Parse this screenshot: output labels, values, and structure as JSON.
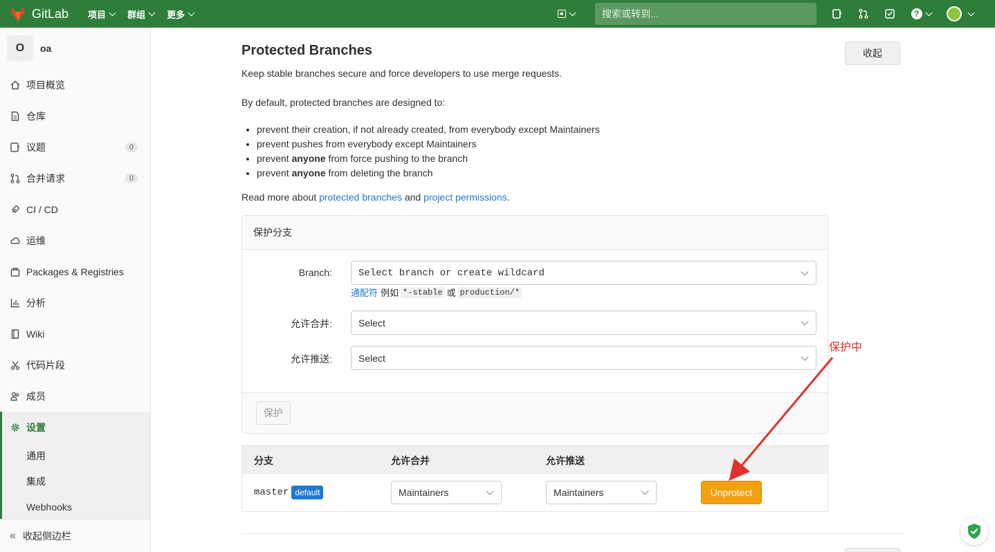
{
  "topbar": {
    "app_name": "GitLab",
    "menu": [
      {
        "label": "项目"
      },
      {
        "label": "群组"
      },
      {
        "label": "更多"
      }
    ],
    "search_placeholder": "搜索或转到..."
  },
  "sidebar": {
    "project_initial": "O",
    "project_name": "oa",
    "items": [
      {
        "label": "项目概览",
        "icon": "home-icon"
      },
      {
        "label": "仓库",
        "icon": "document-icon"
      },
      {
        "label": "议题",
        "icon": "issues-icon",
        "count": "0"
      },
      {
        "label": "合并请求",
        "icon": "merge-request-icon",
        "count": "0"
      },
      {
        "label": "CI / CD",
        "icon": "rocket-icon"
      },
      {
        "label": "运维",
        "icon": "cloud-icon"
      },
      {
        "label": "Packages & Registries",
        "icon": "package-icon"
      },
      {
        "label": "分析",
        "icon": "chart-icon"
      },
      {
        "label": "Wiki",
        "icon": "book-icon"
      },
      {
        "label": "代码片段",
        "icon": "scissors-icon"
      },
      {
        "label": "成员",
        "icon": "users-icon"
      },
      {
        "label": "设置",
        "icon": "gear-icon"
      }
    ],
    "settings_sub": [
      {
        "label": "通用"
      },
      {
        "label": "集成"
      },
      {
        "label": "Webhooks"
      }
    ],
    "collapse_label": "收起侧边栏"
  },
  "main": {
    "title": "Protected Branches",
    "collapse_button": "收起",
    "subtitle": "Keep stable branches secure and force developers to use merge requests.",
    "intro": "By default, protected branches are designed to:",
    "rules": [
      {
        "pre": "prevent their creation, if not already created, from everybody except Maintainers",
        "bold": "",
        "post": ""
      },
      {
        "pre": "prevent pushes from everybody except Maintainers",
        "bold": "",
        "post": ""
      },
      {
        "pre": "prevent ",
        "bold": "anyone",
        "post": " from force pushing to the branch"
      },
      {
        "pre": "prevent ",
        "bold": "anyone",
        "post": " from deleting the branch"
      }
    ],
    "read_more": {
      "prefix": "Read more about ",
      "link1": "protected branches",
      "middle": " and ",
      "link2": "project permissions",
      "suffix": "."
    }
  },
  "form": {
    "heading": "保护分支",
    "branch_label": "Branch:",
    "branch_placeholder": "Select branch or create wildcard",
    "hint_link": "通配符",
    "hint_example": "例如",
    "hint_code1": "*-stable",
    "hint_or": "或",
    "hint_code2": "production/*",
    "merge_label": "允许合并:",
    "merge_value": "Select",
    "push_label": "允许推送:",
    "push_value": "Select",
    "protect_button": "保护"
  },
  "table": {
    "headers": [
      "分支",
      "允许合并",
      "允许推送"
    ],
    "rows": [
      {
        "branch": "master",
        "badge": "default",
        "merge": "Maintainers",
        "push": "Maintainers",
        "action": "Unprotect"
      }
    ]
  },
  "annotation": {
    "text": "保护中",
    "color": "#e0312a"
  },
  "colors": {
    "navbar": "#2f7d3a",
    "link": "#1f78d1",
    "unprotect": "#f2a00f"
  }
}
